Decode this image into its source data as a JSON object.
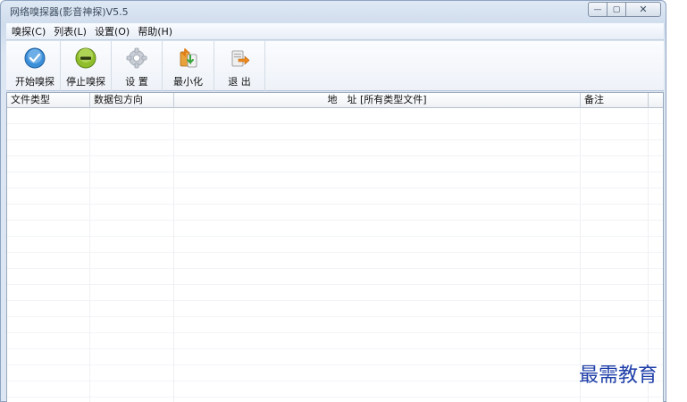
{
  "window": {
    "title": "网络嗅探器(影音神探)V5.5",
    "controls": {
      "minimize": "—",
      "maximize": "▢",
      "close": "✕"
    }
  },
  "menu": [
    {
      "label": "嗅探(C)"
    },
    {
      "label": "列表(L)"
    },
    {
      "label": "设置(O)"
    },
    {
      "label": "帮助(H)"
    }
  ],
  "toolbar": [
    {
      "label": "开始嗅探",
      "icon": "start-sniff-icon"
    },
    {
      "label": "停止嗅探",
      "icon": "stop-sniff-icon"
    },
    {
      "label": "设 置",
      "icon": "settings-gear-icon"
    },
    {
      "label": "最小化",
      "icon": "minimize-icon"
    },
    {
      "label": "退 出",
      "icon": "exit-icon"
    }
  ],
  "table": {
    "columns": [
      {
        "label": "文件类型"
      },
      {
        "label": "数据包方向"
      },
      {
        "label": "地　址 [所有类型文件]"
      },
      {
        "label": "备注"
      }
    ],
    "rows": []
  },
  "watermark": "最需教育",
  "colors": {
    "title_bar": "#cfdcec",
    "start_icon": "#3b8ed8",
    "stop_icon": "#8fbe2a",
    "watermark": "#1f3fa8"
  }
}
